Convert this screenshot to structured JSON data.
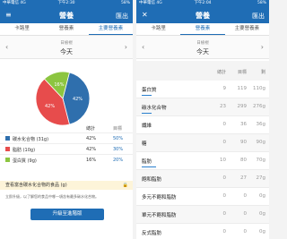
{
  "left": {
    "status_left": "中華電信 4G",
    "status_time": "下午2:30",
    "status_right": "58%",
    "title": "營養",
    "close_label": "匯出",
    "tabs": [
      "卡路里",
      "營養素",
      "主要營養素"
    ],
    "date_mode": "日檢視",
    "date_label": "今天",
    "chart_data": {
      "type": "pie",
      "slices": [
        {
          "name": "碳水化合物",
          "value": 42,
          "color": "#2f6fad"
        },
        {
          "name": "脂肪",
          "value": 42,
          "color": "#e74c4c"
        },
        {
          "name": "蛋白質",
          "value": 16,
          "color": "#8cc540"
        }
      ],
      "labels": [
        "42%",
        "42%",
        "16%"
      ]
    },
    "legend_head_total": "總計",
    "legend_head_goal": "目標",
    "legend": [
      {
        "name": "碳水化合物 (31g)",
        "total": "42%",
        "goal": "50%"
      },
      {
        "name": "脂肪 (10g)",
        "total": "42%",
        "goal": "30%"
      },
      {
        "name": "蛋白質 (9g)",
        "total": "16%",
        "goal": "20%"
      }
    ],
    "hint_title": "查看富含碳水化合物的食品 (g)",
    "hint_body": "立即升級，以了解您的食品中哪一項含有最多碳水化合物。",
    "upgrade_label": "升級至進階版"
  },
  "right": {
    "status_left": "中華電信 4G",
    "status_time": "下午2:04",
    "status_right": "58%",
    "title": "營養",
    "close_label": "匯出",
    "tabs": [
      "卡路里",
      "營養素",
      "主要營養素"
    ],
    "date_mode": "日檢視",
    "date_label": "今天",
    "col_total": "總計",
    "col_goal": "目標",
    "col_left": "剩",
    "nutrients": [
      {
        "name": "蛋白質",
        "total": "9",
        "goal": "119",
        "left": "110g",
        "progress": 0.08
      },
      {
        "name": "碳水化合物",
        "total": "23",
        "goal": "299",
        "left": "276g",
        "progress": 0.08
      },
      {
        "name": "纖維",
        "total": "0",
        "goal": "36",
        "left": "36g",
        "progress": 0
      },
      {
        "name": "糖",
        "total": "0",
        "goal": "90",
        "left": "90g",
        "progress": 0
      },
      {
        "name": "脂肪",
        "total": "10",
        "goal": "80",
        "left": "70g",
        "progress": 0.12
      },
      {
        "name": "飽和脂肪",
        "total": "0",
        "goal": "27",
        "left": "27g",
        "progress": 0
      },
      {
        "name": "多元不飽和脂肪",
        "total": "0",
        "goal": "0",
        "left": "0g",
        "progress": 0
      },
      {
        "name": "單元不飽和脂肪",
        "total": "0",
        "goal": "0",
        "left": "0g",
        "progress": 0
      },
      {
        "name": "反式脂肪",
        "total": "0",
        "goal": "0",
        "left": "0g",
        "progress": 0
      }
    ]
  }
}
